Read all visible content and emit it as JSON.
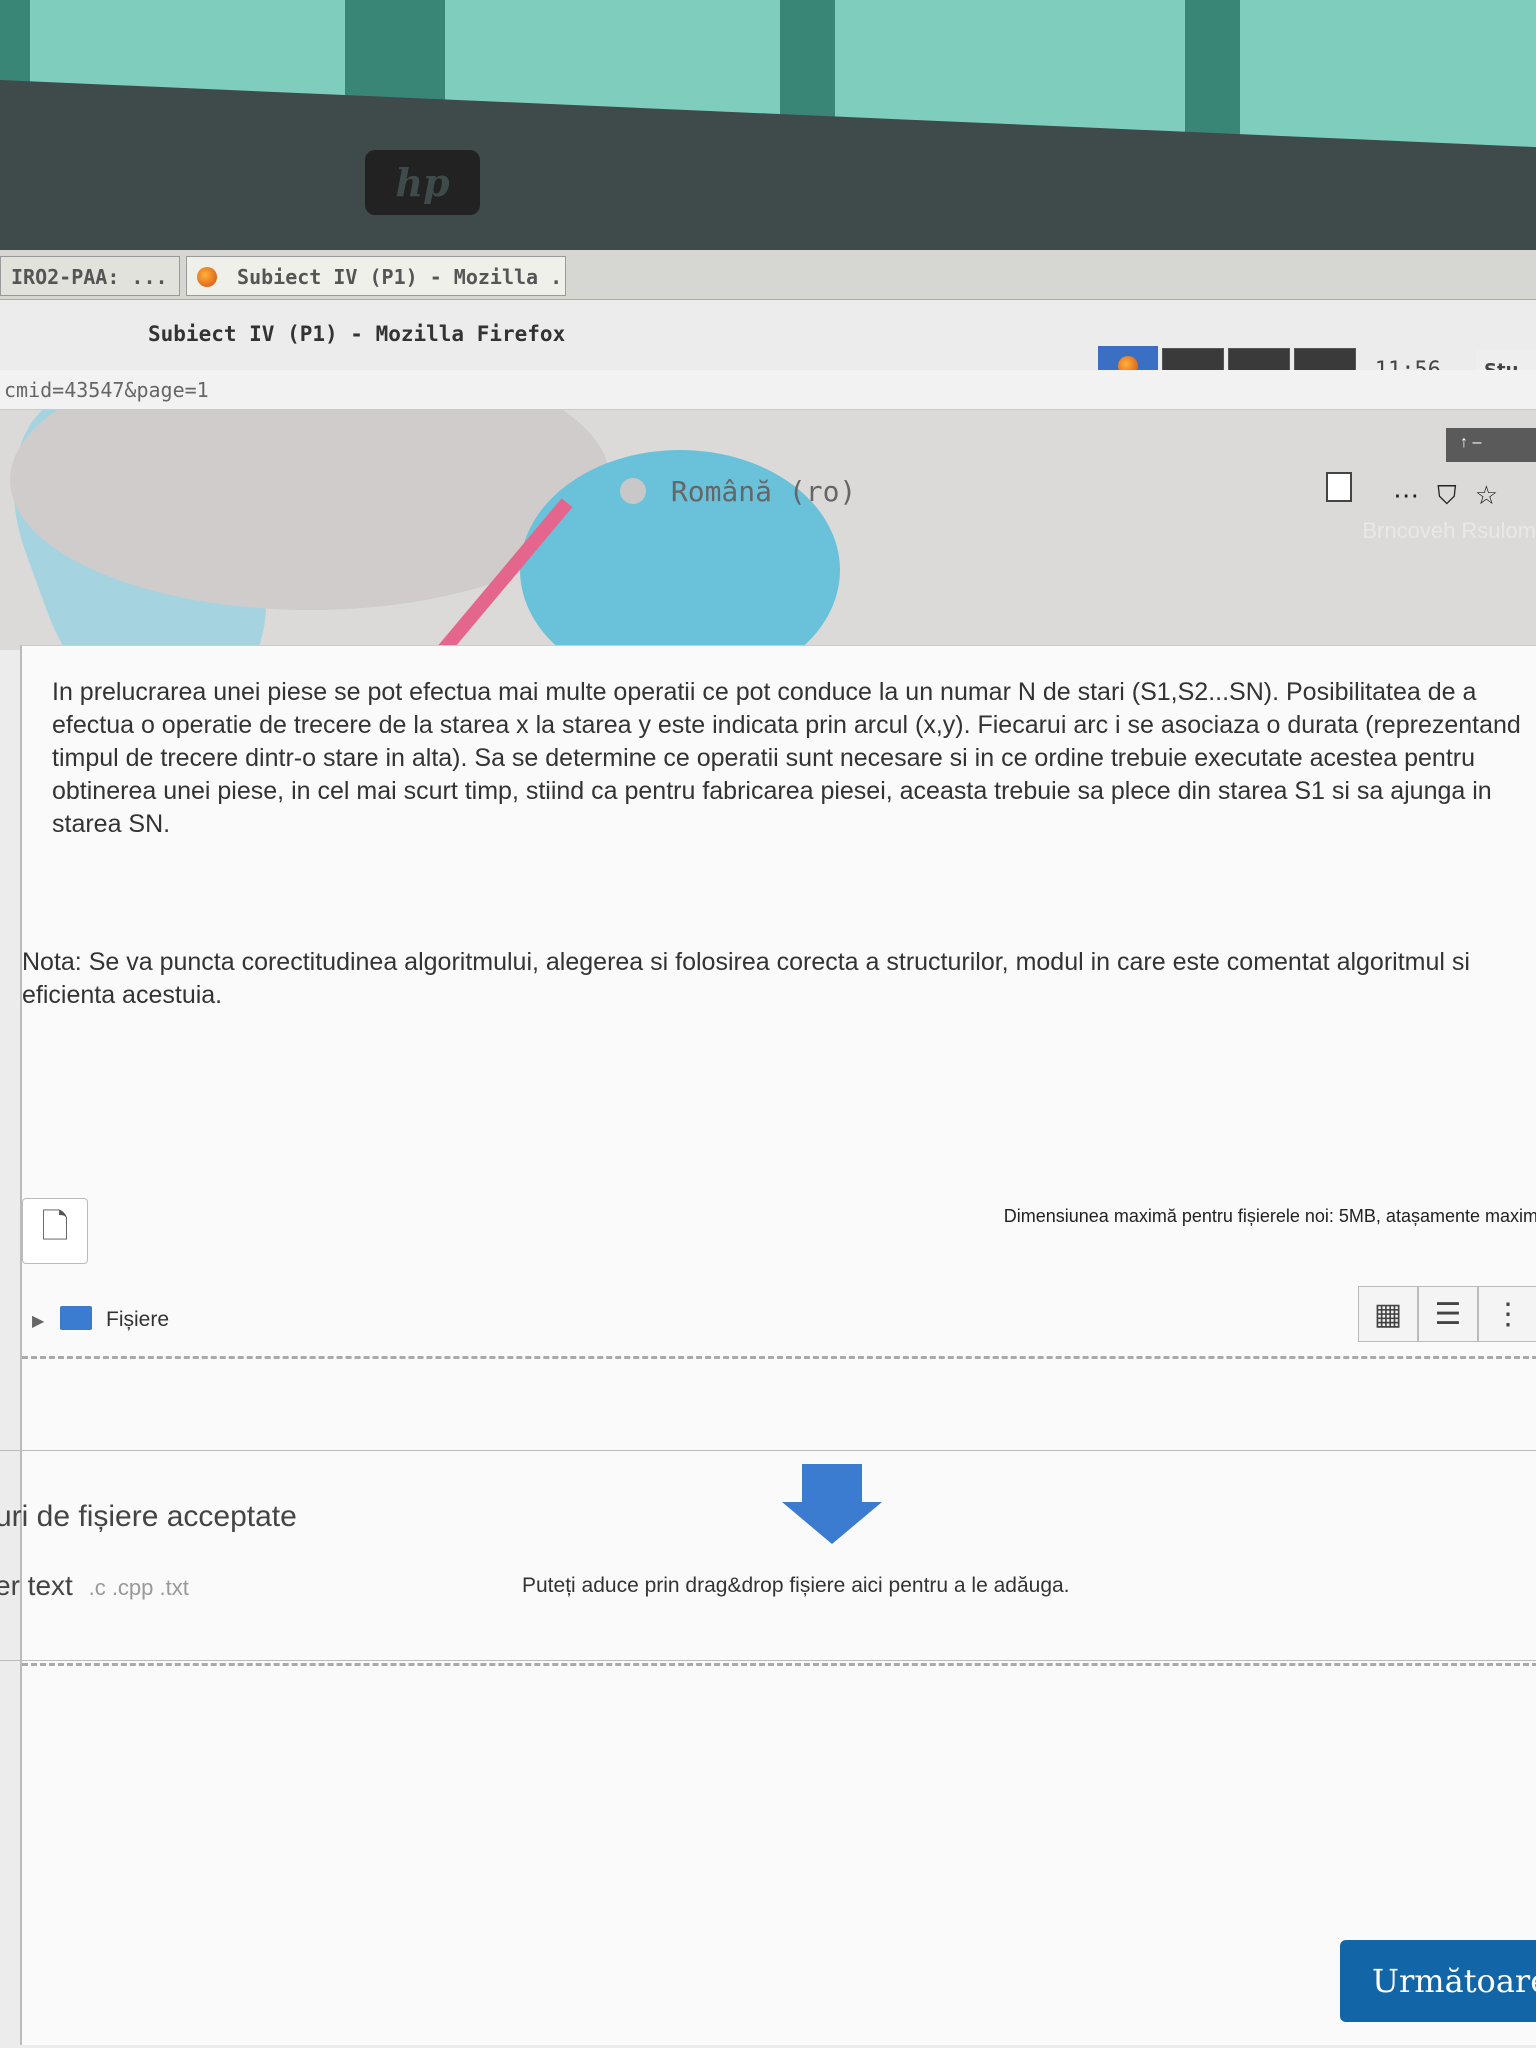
{
  "taskbar": {
    "tab1": "IRO2-PAA: ...",
    "tab2": "Subiect IV (P1) - Mozilla ...",
    "clock": "11:56",
    "tray": "Stu"
  },
  "window": {
    "title": "Subiect IV (P1) - Mozilla Firefox",
    "url": "cmid=43547&page=1"
  },
  "header": {
    "language": "Română (ro)",
    "user_faded": "Brncoveh Rsulom"
  },
  "question": {
    "text": "In prelucrarea unei piese se pot efectua mai multe operatii ce pot conduce la un numar N de stari (S1,S2...SN). Posibilitatea de a efectua o operatie de trecere de la starea x la starea y este indicata prin arcul (x,y). Fiecarui arc i se asociaza o durata (reprezentand timpul de trecere dintr-o stare in alta). Sa se determine ce operatii sunt necesare si in ce ordine trebuie executate acestea pentru obtinerea unei piese, in cel mai scurt timp, stiind ca pentru fabricarea piesei, aceasta trebuie sa plece din starea S1 si sa ajunga in starea SN.",
    "note": "Nota: Se va puncta corectitudinea algoritmului, alegerea si folosirea corecta a structurilor, modul in care este comentat algoritmul si eficienta acestuia."
  },
  "filemanager": {
    "max_size": "Dimensiunea maximă pentru fișierele noi: 5MB, atașamente maxim",
    "folder_label": "Fișiere",
    "drop_text": "Puteți aduce prin drag&drop fișiere aici pentru a le adăuga."
  },
  "accepted": {
    "title": "uri de fișiere acceptate",
    "type_label": "er text",
    "extensions": ".c .cpp .txt"
  },
  "next_button": "Următoare",
  "colors": {
    "accent": "#1266a7",
    "drop_arrow": "#3b7bd0",
    "banner_blue": "#69c1da",
    "banner_pink": "#e5668d"
  }
}
